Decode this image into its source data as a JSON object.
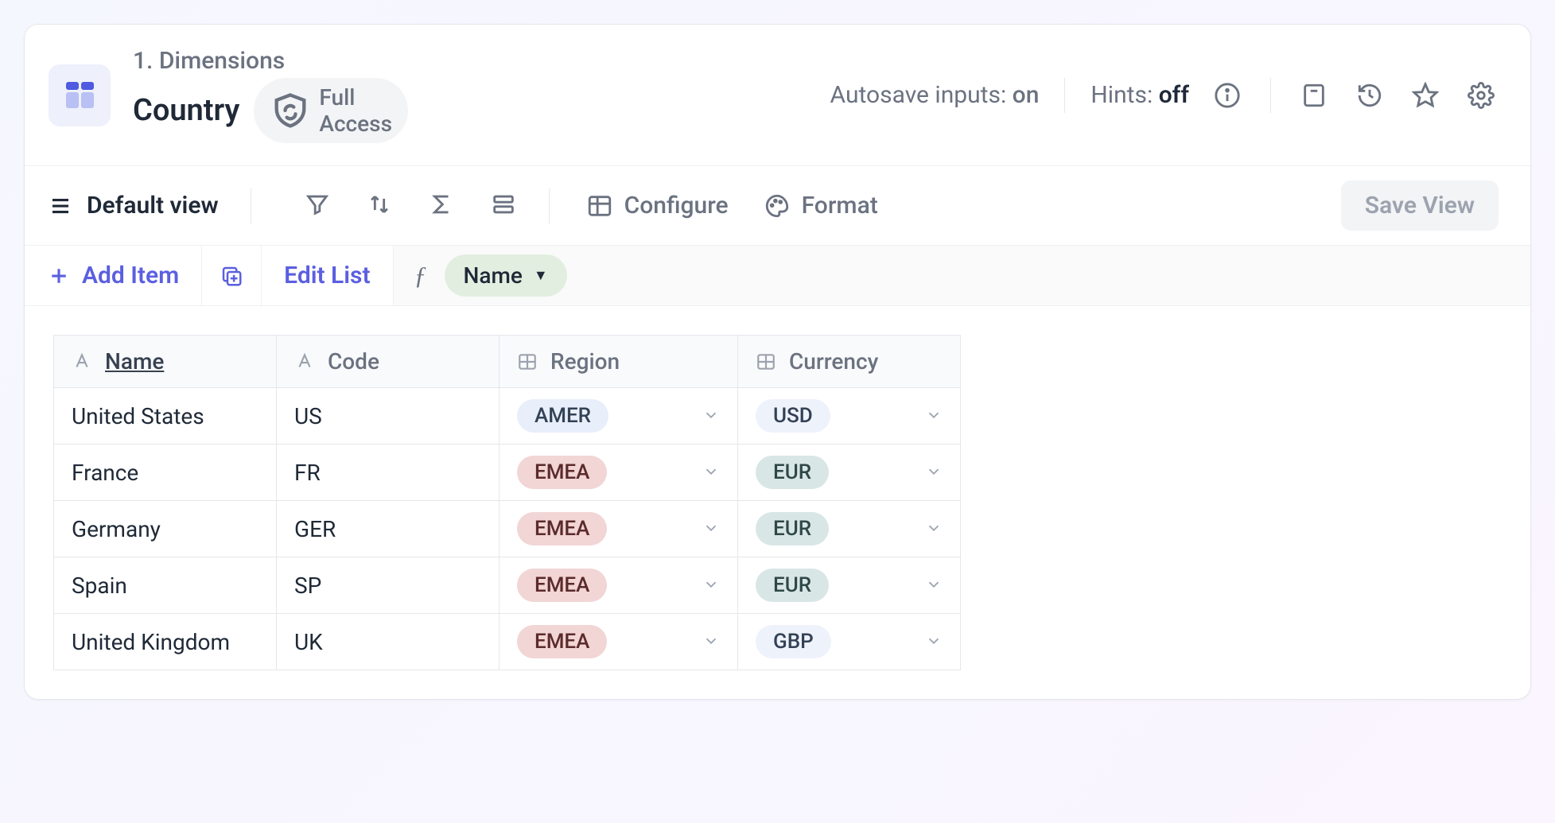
{
  "breadcrumb": "1. Dimensions",
  "title": "Country",
  "access": {
    "label": "Full Access"
  },
  "status": {
    "autosave_label": "Autosave inputs:",
    "autosave_value": "on",
    "hints_label": "Hints:",
    "hints_value": "off"
  },
  "toolbar": {
    "view_label": "Default view",
    "configure": "Configure",
    "format": "Format",
    "save_view": "Save View"
  },
  "actions": {
    "add_item": "Add Item",
    "edit_list": "Edit List",
    "formula_chip": "Name"
  },
  "table": {
    "columns": [
      {
        "label": "Name",
        "type": "text",
        "sorted": true
      },
      {
        "label": "Code",
        "type": "text",
        "sorted": false
      },
      {
        "label": "Region",
        "type": "pill",
        "sorted": false
      },
      {
        "label": "Currency",
        "type": "pill",
        "sorted": false
      }
    ],
    "rows": [
      {
        "name": "United States",
        "code": "US",
        "region": "AMER",
        "region_color": "blue",
        "currency": "USD",
        "currency_color": "light"
      },
      {
        "name": "France",
        "code": "FR",
        "region": "EMEA",
        "region_color": "red",
        "currency": "EUR",
        "currency_color": "teal"
      },
      {
        "name": "Germany",
        "code": "GER",
        "region": "EMEA",
        "region_color": "red",
        "currency": "EUR",
        "currency_color": "teal"
      },
      {
        "name": "Spain",
        "code": "SP",
        "region": "EMEA",
        "region_color": "red",
        "currency": "EUR",
        "currency_color": "teal"
      },
      {
        "name": "United Kingdom",
        "code": "UK",
        "region": "EMEA",
        "region_color": "red",
        "currency": "GBP",
        "currency_color": "light"
      }
    ]
  }
}
